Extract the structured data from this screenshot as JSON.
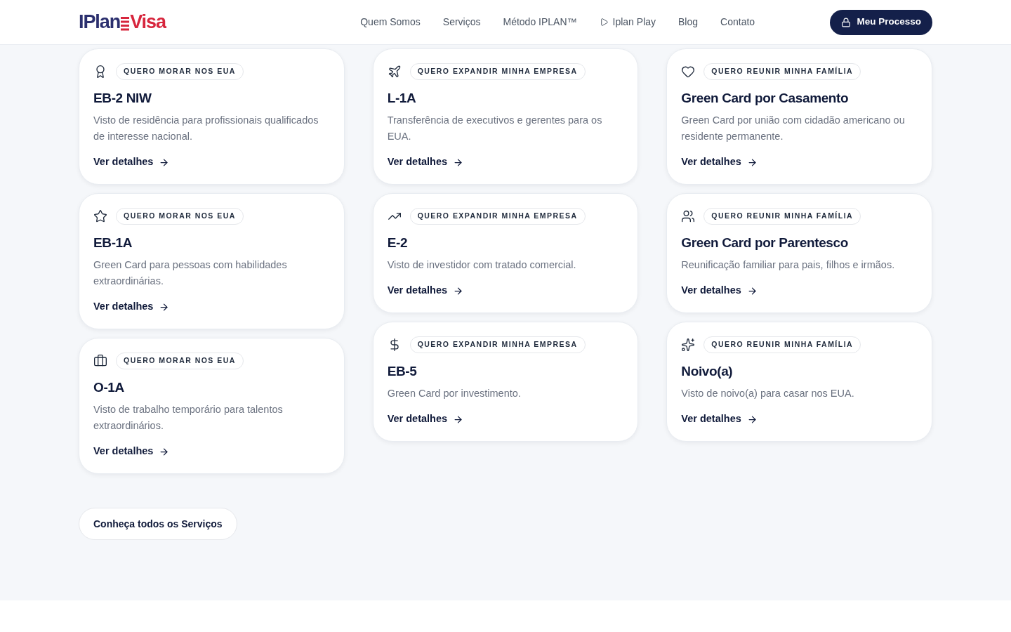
{
  "header": {
    "logo": {
      "part_1": "IPlan",
      "part_2": "Visa"
    },
    "nav": [
      {
        "label": "Quem Somos",
        "kind": "link"
      },
      {
        "label": "Serviços",
        "kind": "link"
      },
      {
        "label": "Método IPLAN™",
        "kind": "link"
      },
      {
        "label": "Iplan Play",
        "kind": "play"
      },
      {
        "label": "Blog",
        "kind": "link"
      },
      {
        "label": "Contato",
        "kind": "link"
      }
    ],
    "cta": "Meu Processo"
  },
  "columns": [
    {
      "cards": [
        {
          "tag": "QUERO MORAR NOS EUA",
          "title": "EB-2 NIW",
          "description": "Visto de residência para profissionais qualificados de interesse nacional.",
          "link": "Ver detalhes"
        },
        {
          "tag": "QUERO MORAR NOS EUA",
          "title": "EB-1A",
          "description": "Green Card para pessoas com habilidades extraordinárias.",
          "link": "Ver detalhes"
        },
        {
          "tag": "QUERO MORAR NOS EUA",
          "title": "O-1A",
          "description": "Visto de trabalho temporário para talentos extraordinários.",
          "link": "Ver detalhes"
        }
      ]
    },
    {
      "cards": [
        {
          "tag": "QUERO EXPANDIR MINHA EMPRESA",
          "title": "L-1A",
          "description": "Transferência de executivos e gerentes para os EUA.",
          "link": "Ver detalhes"
        },
        {
          "tag": "QUERO EXPANDIR MINHA EMPRESA",
          "title": "E-2",
          "description": "Visto de investidor com tratado comercial.",
          "link": "Ver detalhes"
        },
        {
          "tag": "QUERO EXPANDIR MINHA EMPRESA",
          "title": "EB-5",
          "description": "Green Card por investimento.",
          "link": "Ver detalhes"
        }
      ]
    },
    {
      "cards": [
        {
          "tag": "QUERO REUNIR MINHA FAMÍLIA",
          "title": "Green Card por Casamento",
          "description": "Green Card por união com cidadão americano ou residente permanente.",
          "link": "Ver detalhes"
        },
        {
          "tag": "QUERO REUNIR MINHA FAMÍLIA",
          "title": "Green Card por Parentesco",
          "description": "Reunificação familiar para pais, filhos e irmãos.",
          "link": "Ver detalhes"
        },
        {
          "tag": "QUERO REUNIR MINHA FAMÍLIA",
          "title": "Noivo(a)",
          "description": "Visto de noivo(a) para casar nos EUA.",
          "link": "Ver detalhes"
        }
      ]
    }
  ],
  "all_services_button": "Conheça todos os Serviços"
}
